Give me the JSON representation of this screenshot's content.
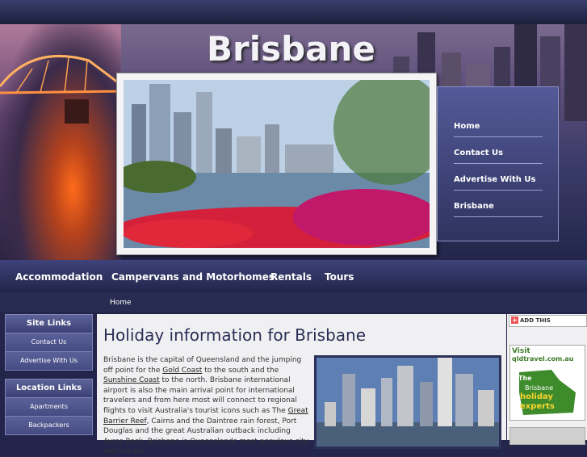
{
  "header": {
    "title": "Brisbane"
  },
  "side_menu": {
    "items": [
      "Home",
      "Contact Us",
      "Advertise With Us",
      "Brisbane"
    ]
  },
  "nav": {
    "items": [
      "Accommodation",
      "Campervans and Motorhomes",
      "Rentals",
      "Tours"
    ]
  },
  "breadcrumb": {
    "label": "Home"
  },
  "left": {
    "site_links": {
      "title": "Site Links",
      "items": [
        "Contact Us",
        "Advertise With Us"
      ]
    },
    "location_links": {
      "title": "Location Links",
      "items": [
        "Apartments",
        "Backpackers"
      ]
    }
  },
  "content": {
    "heading": "Holiday information for Brisbane",
    "p1": "Brisbane is the capital of Queensland and the jumping off point for the ",
    "link1": "Gold Coast",
    "p2": " to the south and the ",
    "link2": "Sunshine Coast",
    "p3": " to the north. Brisbane international airport is also the main arrival point for international travelers and from here most will connect to regional flights to visit Australia's tourist icons such as The ",
    "link3": "Great Barrier Reef",
    "p4": ", Cairns and the Daintree rain forest, Port Douglas and the great Australian outback including Ayres Rock. Brisbane is Queenslands most populous city and lies on"
  },
  "right": {
    "addthis_label": "ADD THIS",
    "ad": {
      "visit": "Visit",
      "url": "qldtravel.com.au",
      "line1": "The",
      "line2": "Brisbane",
      "line3": "holiday",
      "line4": "experts"
    }
  },
  "colors": {
    "accent": "#2a2d55",
    "nav_bg": "#2e3262",
    "ad_green": "#3d7a2a"
  }
}
